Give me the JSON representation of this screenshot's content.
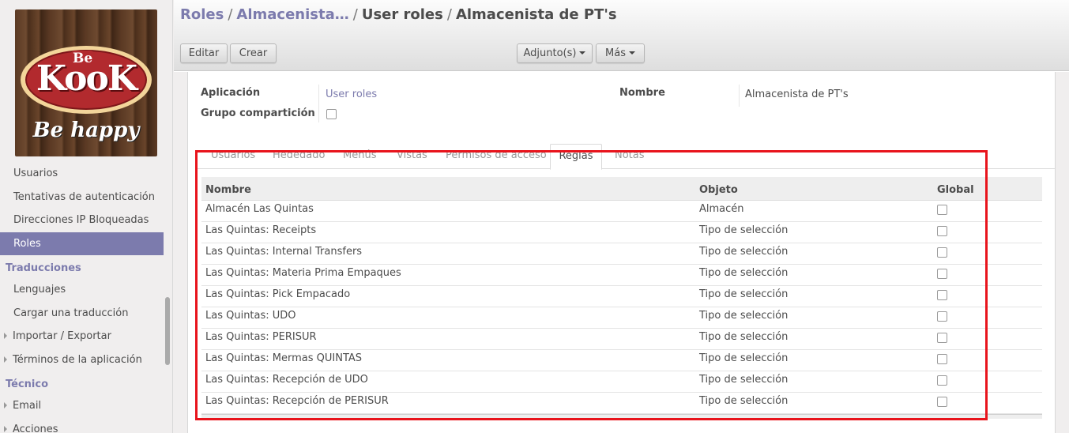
{
  "sidebar": {
    "logo": {
      "top_word": "Be",
      "brand": "KooK",
      "tagline": "Be happy"
    },
    "items": [
      {
        "label": "Usuarios",
        "kind": "item"
      },
      {
        "label": "Tentativas de autenticación",
        "kind": "item"
      },
      {
        "label": "Direcciones IP Bloqueadas",
        "kind": "item"
      },
      {
        "label": "Roles",
        "kind": "item",
        "active": true
      },
      {
        "label": "Traducciones",
        "kind": "header"
      },
      {
        "label": "Lenguajes",
        "kind": "item"
      },
      {
        "label": "Cargar una traducción",
        "kind": "item"
      },
      {
        "label": "Importar / Exportar",
        "kind": "expandable"
      },
      {
        "label": "Términos de la aplicación",
        "kind": "expandable"
      },
      {
        "label": "Técnico",
        "kind": "header"
      },
      {
        "label": "Email",
        "kind": "expandable"
      },
      {
        "label": "Acciones",
        "kind": "expandable"
      }
    ]
  },
  "breadcrumb": {
    "items": [
      "Roles",
      "Almacenista…",
      "User roles",
      "Almacenista de PT's"
    ],
    "separator": "/"
  },
  "toolbar": {
    "edit_label": "Editar",
    "create_label": "Crear",
    "attachments_label": "Adjunto(s)",
    "more_label": "Más"
  },
  "form": {
    "application_label": "Aplicación",
    "application_value": "User roles",
    "sharing_group_label": "Grupo compartición",
    "sharing_group_checked": false,
    "name_label": "Nombre",
    "name_value": "Almacenista de PT's"
  },
  "tabs": [
    {
      "label": "Usuarios"
    },
    {
      "label": "Hededado"
    },
    {
      "label": "Menús"
    },
    {
      "label": "Vistas"
    },
    {
      "label": "Permisos de acceso"
    },
    {
      "label": "Reglas",
      "active": true
    },
    {
      "label": "Notas"
    }
  ],
  "rules_table": {
    "columns": [
      "Nombre",
      "Objeto",
      "Global"
    ],
    "rows": [
      {
        "name": "Almacén Las Quintas",
        "object": "Almacén",
        "global": false
      },
      {
        "name": "Las Quintas: Receipts",
        "object": "Tipo de selección",
        "global": false
      },
      {
        "name": "Las Quintas: Internal Transfers",
        "object": "Tipo de selección",
        "global": false
      },
      {
        "name": "Las Quintas: Materia Prima Empaques",
        "object": "Tipo de selección",
        "global": false
      },
      {
        "name": "Las Quintas: Pick Empacado",
        "object": "Tipo de selección",
        "global": false
      },
      {
        "name": "Las Quintas: UDO",
        "object": "Tipo de selección",
        "global": false
      },
      {
        "name": "Las Quintas: PERISUR",
        "object": "Tipo de selección",
        "global": false
      },
      {
        "name": "Las Quintas: Mermas QUINTAS",
        "object": "Tipo de selección",
        "global": false
      },
      {
        "name": "Las Quintas: Recepción de UDO",
        "object": "Tipo de selección",
        "global": false
      },
      {
        "name": "Las Quintas: Recepción de PERISUR",
        "object": "Tipo de selección",
        "global": false
      }
    ]
  },
  "colors": {
    "accent": "#7c7bad",
    "highlight_border": "#e8141c",
    "logo_red": "#b22a2e"
  }
}
